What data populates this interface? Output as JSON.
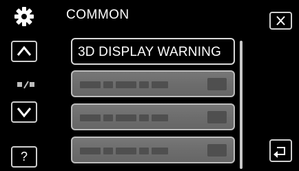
{
  "header": {
    "title": "COMMON",
    "icon": "gear-icon"
  },
  "controls": {
    "close_icon": "close-icon",
    "up_icon": "chevron-up-icon",
    "down_icon": "chevron-down-icon",
    "help_label": "?",
    "back_icon": "back-arrow-icon",
    "page_indicator_icon": "page-indicator-icon"
  },
  "menu": {
    "items": [
      {
        "label": "3D DISPLAY WARNING",
        "active": true
      },
      {
        "label": "",
        "active": false
      },
      {
        "label": "",
        "active": false
      },
      {
        "label": "",
        "active": false
      }
    ]
  },
  "colors": {
    "background": "#000000",
    "button_border": "#cfcfcf",
    "item_fill": "#6f6f6f"
  }
}
